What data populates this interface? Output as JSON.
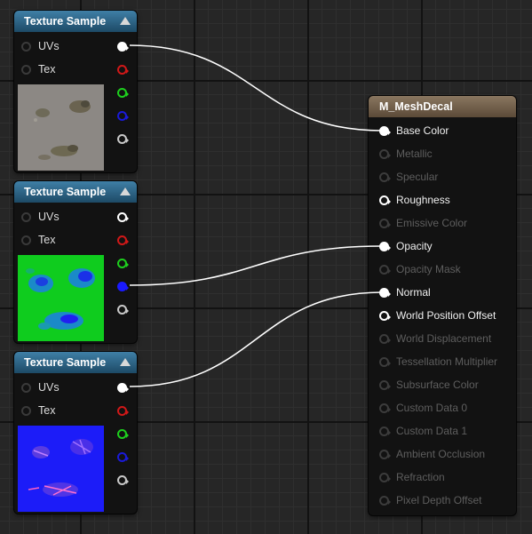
{
  "texture_nodes": [
    {
      "title": "Texture Sample",
      "inputs": [
        {
          "label": "UVs"
        },
        {
          "label": "Tex"
        }
      ],
      "outputs": [
        {
          "color": "#ffffff",
          "filled": true,
          "connected": true
        },
        {
          "color": "#d01818",
          "filled": false
        },
        {
          "color": "#1ecf1e",
          "filled": false
        },
        {
          "color": "#1a1ad8",
          "filled": false
        },
        {
          "color": "#c8c8c8",
          "filled": false
        }
      ],
      "thumbnail": "decal-color-texture"
    },
    {
      "title": "Texture Sample",
      "inputs": [
        {
          "label": "UVs"
        },
        {
          "label": "Tex"
        }
      ],
      "outputs": [
        {
          "color": "#ffffff",
          "filled": false
        },
        {
          "color": "#d01818",
          "filled": false
        },
        {
          "color": "#1ecf1e",
          "filled": false
        },
        {
          "color": "#1a1aff",
          "filled": true,
          "connected": true
        },
        {
          "color": "#c8c8c8",
          "filled": false
        }
      ],
      "thumbnail": "decal-mask-texture"
    },
    {
      "title": "Texture Sample",
      "inputs": [
        {
          "label": "UVs"
        },
        {
          "label": "Tex"
        }
      ],
      "outputs": [
        {
          "color": "#ffffff",
          "filled": true,
          "connected": true
        },
        {
          "color": "#d01818",
          "filled": false
        },
        {
          "color": "#1ecf1e",
          "filled": false
        },
        {
          "color": "#1a1ad8",
          "filled": false
        },
        {
          "color": "#c8c8c8",
          "filled": false
        }
      ],
      "thumbnail": "decal-normal-texture"
    }
  ],
  "material_node": {
    "title": "M_MeshDecal",
    "inputs": [
      {
        "label": "Base Color",
        "enabled": true,
        "connected": true
      },
      {
        "label": "Metallic",
        "enabled": false
      },
      {
        "label": "Specular",
        "enabled": false
      },
      {
        "label": "Roughness",
        "enabled": true
      },
      {
        "label": "Emissive Color",
        "enabled": false
      },
      {
        "label": "Opacity",
        "enabled": true,
        "connected": true
      },
      {
        "label": "Opacity Mask",
        "enabled": false
      },
      {
        "label": "Normal",
        "enabled": true,
        "connected": true
      },
      {
        "label": "World Position Offset",
        "enabled": true
      },
      {
        "label": "World Displacement",
        "enabled": false
      },
      {
        "label": "Tessellation Multiplier",
        "enabled": false
      },
      {
        "label": "Subsurface Color",
        "enabled": false
      },
      {
        "label": "Custom Data 0",
        "enabled": false
      },
      {
        "label": "Custom Data 1",
        "enabled": false
      },
      {
        "label": "Ambient Occlusion",
        "enabled": false
      },
      {
        "label": "Refraction",
        "enabled": false
      },
      {
        "label": "Pixel Depth Offset",
        "enabled": false
      }
    ]
  },
  "colors": {
    "texture_header": "#2b6588",
    "material_header": "#7a6752",
    "wire": "#ffffff",
    "graph_background": "#262626"
  }
}
